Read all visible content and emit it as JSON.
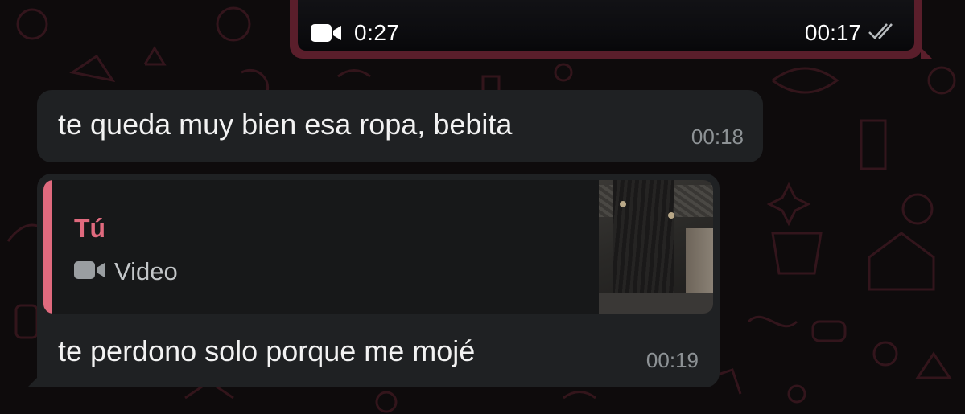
{
  "colors": {
    "background": "#0e0b0c",
    "outgoing_bubble": "#5a1e2b",
    "incoming_bubble": "#1f2123",
    "quote_accent": "#e06a7e",
    "timestamp": "#8d9295"
  },
  "outgoing_video": {
    "duration": "0:27",
    "time": "00:17",
    "duration_icon": "video-camera-icon",
    "status_icon": "double-check-icon"
  },
  "messages": [
    {
      "text": "te queda muy bien esa ropa, bebita",
      "time": "00:18"
    },
    {
      "quote": {
        "author": "Tú",
        "type_label": "Video",
        "type_icon": "video-camera-icon"
      },
      "text": "te perdono solo porque me mojé",
      "time": "00:19"
    }
  ]
}
